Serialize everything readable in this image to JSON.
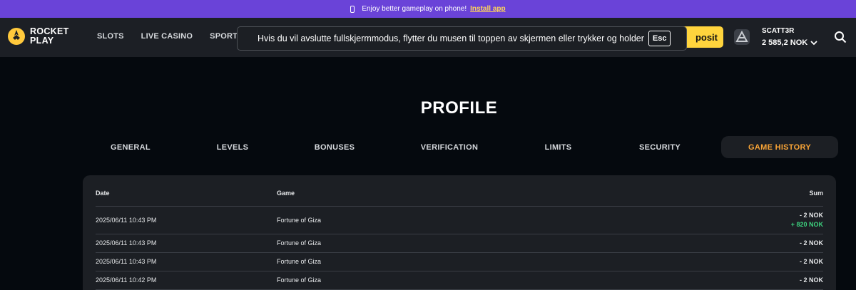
{
  "promo": {
    "text": "Enjoy better gameplay on phone!",
    "link": "Install app"
  },
  "logo": {
    "line1": "ROCKET",
    "line2": "PLAY"
  },
  "nav": [
    "SLOTS",
    "LIVE CASINO",
    "SPORTS"
  ],
  "deposit_label": "posit",
  "user": {
    "name": "SCATT3R",
    "balance": "2 585,2 NOK"
  },
  "fullscreen_notice": {
    "text": "Hvis du vil avslutte fullskjermmodus, flytter du musen til toppen av skjermen eller trykker og holder",
    "key": "Esc"
  },
  "page_title": "PROFILE",
  "tabs": [
    "GENERAL",
    "LEVELS",
    "BONUSES",
    "VERIFICATION",
    "LIMITS",
    "SECURITY",
    "GAME HISTORY"
  ],
  "active_tab": "GAME HISTORY",
  "table": {
    "headers": {
      "date": "Date",
      "game": "Game",
      "sum": "Sum"
    },
    "rows": [
      {
        "date": "2025/06/11 10:43 PM",
        "game": "Fortune of Giza",
        "sum": "- 2 NOK",
        "win": "+ 820 NOK"
      },
      {
        "date": "2025/06/11 10:43 PM",
        "game": "Fortune of Giza",
        "sum": "- 2 NOK"
      },
      {
        "date": "2025/06/11 10:43 PM",
        "game": "Fortune of Giza",
        "sum": "- 2 NOK"
      },
      {
        "date": "2025/06/11 10:42 PM",
        "game": "Fortune of Giza",
        "sum": "- 2 NOK"
      }
    ]
  },
  "colors": {
    "promo_bar": "#6a43d8",
    "accent_yellow": "#ffd43d",
    "active_tab_text": "#f7a336",
    "win_green": "#3dd17e"
  },
  "icons": [
    "phone-icon",
    "rocket-logo-icon",
    "avatar-icon",
    "chevron-down-icon",
    "search-icon"
  ]
}
